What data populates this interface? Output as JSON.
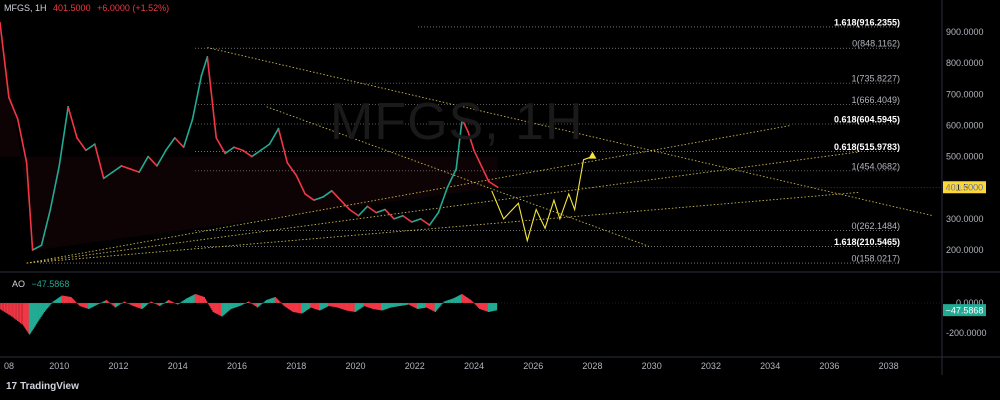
{
  "header": {
    "symbol": "MFGS, 1H",
    "price": "401.5000",
    "change": "+6.0000 (+1.52%)"
  },
  "watermark": "MFGS, 1H",
  "oscillator": {
    "label": "AO",
    "value": "−47.5868"
  },
  "branding": {
    "name": "TradingView"
  },
  "colors": {
    "up": "#22ab94",
    "down": "#f23645",
    "fib_line": "#b5b5b5",
    "trendline": "#c8b64a",
    "projection": "#f5e63c",
    "price_tag_bg": "#fdd835",
    "ao_tag_bg": "#22ab94"
  },
  "chart_data": {
    "type": "line",
    "x_axis": {
      "label_1": "08",
      "labels": [
        "2010",
        "2012",
        "2014",
        "2016",
        "2018",
        "2020",
        "2022",
        "2024",
        "2026",
        "2028",
        "2030",
        "2032",
        "2034",
        "2036",
        "2038"
      ]
    },
    "y_axis": {
      "labels": [
        "900.0000",
        "800.0000",
        "700.0000",
        "600.0000",
        "500.0000",
        "400.0000",
        "300.0000",
        "200.0000"
      ],
      "ylim": [
        130,
        960
      ]
    },
    "last_price": {
      "value": 401.5,
      "label": "401.5000"
    },
    "fib_levels": [
      {
        "label": "1.618(916.2355)",
        "value": 916.2355,
        "bold": true
      },
      {
        "label": "0(848.1162)",
        "value": 848.1162,
        "bold": false
      },
      {
        "label": "1(735.8227)",
        "value": 735.8227,
        "bold": false
      },
      {
        "label": "1(666.4049)",
        "value": 666.4049,
        "bold": false
      },
      {
        "label": "0.618(604.5945)",
        "value": 604.5945,
        "bold": true
      },
      {
        "label": "0.618(515.9783)",
        "value": 515.9783,
        "bold": true
      },
      {
        "label": "1(454.0682)",
        "value": 454.0682,
        "bold": false
      },
      {
        "label": "0(262.1484)",
        "value": 262.1484,
        "bold": false
      },
      {
        "label": "1.618(210.5465)",
        "value": 210.5465,
        "bold": true
      },
      {
        "label": "0(158.0217)",
        "value": 158.0217,
        "bold": false
      }
    ],
    "price_series": {
      "name": "MFGS",
      "x": [
        2008.0,
        2008.3,
        2008.6,
        2008.9,
        2009.1,
        2009.4,
        2009.7,
        2010.0,
        2010.3,
        2010.6,
        2010.9,
        2011.2,
        2011.5,
        2011.8,
        2012.1,
        2012.4,
        2012.7,
        2013.0,
        2013.3,
        2013.6,
        2013.9,
        2014.2,
        2014.5,
        2014.8,
        2015.0,
        2015.3,
        2015.6,
        2015.9,
        2016.2,
        2016.5,
        2016.8,
        2017.1,
        2017.4,
        2017.7,
        2018.0,
        2018.3,
        2018.6,
        2018.9,
        2019.2,
        2019.5,
        2019.8,
        2020.1,
        2020.4,
        2020.7,
        2021.0,
        2021.3,
        2021.6,
        2021.9,
        2022.2,
        2022.5,
        2022.8,
        2023.1,
        2023.4,
        2023.6,
        2023.8,
        2024.0,
        2024.2,
        2024.5,
        2024.8
      ],
      "values": [
        930,
        690,
        620,
        480,
        200,
        215,
        330,
        470,
        660,
        560,
        520,
        540,
        430,
        450,
        470,
        460,
        450,
        500,
        470,
        520,
        560,
        530,
        620,
        760,
        820,
        560,
        510,
        530,
        520,
        500,
        520,
        540,
        590,
        480,
        440,
        380,
        360,
        370,
        390,
        360,
        330,
        310,
        340,
        320,
        330,
        300,
        310,
        290,
        300,
        280,
        320,
        400,
        460,
        620,
        580,
        520,
        480,
        420,
        401.5
      ]
    },
    "trendlines": [
      {
        "from": [
          2015.0,
          850
        ],
        "to": [
          2039.5,
          310
        ]
      },
      {
        "from": [
          2017.0,
          660
        ],
        "to": [
          2029.9,
          212
        ]
      },
      {
        "from": [
          2008.9,
          158
        ],
        "to": [
          2037.0,
          515
        ]
      },
      {
        "from": [
          2008.9,
          158
        ],
        "to": [
          2034.7,
          600
        ]
      },
      {
        "from": [
          2008.9,
          158
        ],
        "to": [
          2037.0,
          385
        ]
      }
    ],
    "projection": {
      "x": [
        2024.6,
        2025.0,
        2025.5,
        2025.8,
        2026.1,
        2026.4,
        2026.7,
        2026.9,
        2027.2,
        2027.4,
        2027.7,
        2028.0
      ],
      "values": [
        390,
        300,
        350,
        230,
        330,
        270,
        360,
        300,
        380,
        330,
        490,
        500
      ]
    },
    "ao_series": {
      "name": "AO",
      "ylim": [
        -260,
        80
      ],
      "ticks": [
        "0.0000",
        "-200.0000"
      ],
      "last_value": -47.5868,
      "last_label": "−47.5868",
      "x": [
        2008.0,
        2008.4,
        2008.8,
        2009.0,
        2009.2,
        2009.5,
        2009.8,
        2010.1,
        2010.4,
        2010.7,
        2011.0,
        2011.3,
        2011.6,
        2011.9,
        2012.2,
        2012.5,
        2012.8,
        2013.1,
        2013.4,
        2013.7,
        2014.0,
        2014.3,
        2014.6,
        2014.9,
        2015.2,
        2015.5,
        2015.8,
        2016.1,
        2016.4,
        2016.7,
        2017.0,
        2017.3,
        2017.6,
        2017.9,
        2018.2,
        2018.5,
        2018.8,
        2019.1,
        2019.4,
        2019.7,
        2020.0,
        2020.3,
        2020.6,
        2020.9,
        2021.2,
        2021.5,
        2021.8,
        2022.1,
        2022.4,
        2022.7,
        2023.0,
        2023.3,
        2023.6,
        2023.9,
        2024.2,
        2024.5,
        2024.8
      ],
      "values": [
        -40,
        -90,
        -150,
        -210,
        -150,
        -60,
        10,
        50,
        40,
        -20,
        -40,
        -10,
        20,
        -30,
        10,
        -20,
        -40,
        10,
        -20,
        20,
        -10,
        30,
        60,
        40,
        -60,
        -90,
        -40,
        -20,
        10,
        -30,
        20,
        40,
        -20,
        -60,
        -70,
        -30,
        -50,
        -20,
        -30,
        -50,
        -60,
        -20,
        -40,
        -50,
        -30,
        -20,
        -10,
        -40,
        -30,
        -60,
        10,
        30,
        60,
        20,
        -40,
        -60,
        -47.6
      ]
    }
  }
}
